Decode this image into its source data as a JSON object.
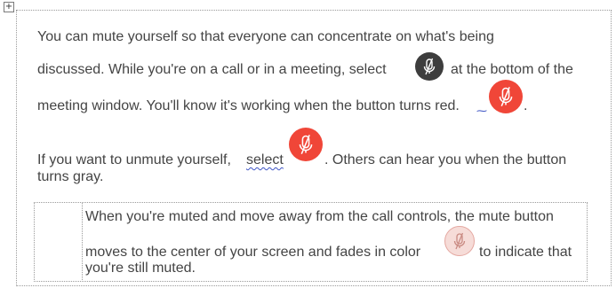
{
  "para1": {
    "line1": "You can mute yourself so that everyone can concentrate on what's being",
    "line2_a": "discussed. While you're on a call or in a meeting, select",
    "line2_b": "at the bottom of the",
    "line3_a": "meeting window. You'll know it's working when the button turns red.",
    "line3_b": "."
  },
  "para2": {
    "line1_a": "If you want to unmute yourself,",
    "line1_select": "select",
    "line1_b": ". Others can hear you when the button",
    "line2": "turns gray."
  },
  "note": {
    "line1": "When you're muted and move away from the call controls, the mute button",
    "line2_a": "moves to the center of your screen and fades in color",
    "line2_b": "to indicate that",
    "line3": "you're still muted."
  },
  "icons": {
    "mute_dark": "mic-off-icon",
    "mute_red": "mic-off-icon",
    "mute_faded": "mic-off-icon"
  },
  "colors": {
    "text": "#444444",
    "button_dark": "#3d3d3d",
    "button_red": "#f04638",
    "button_faded": "#f6dcd8"
  }
}
